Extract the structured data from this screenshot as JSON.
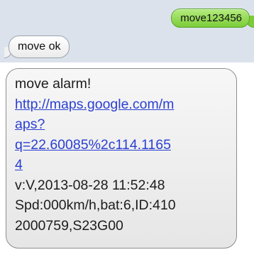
{
  "conversation": {
    "outgoing": {
      "text": "move123456"
    },
    "reply": {
      "text": "move ok"
    },
    "alarm": {
      "title": "move alarm!",
      "link_lines": [
        "http://maps.google.com/m",
        "aps?",
        "q=22.60085%2c114.1165",
        "4"
      ],
      "body_lines": [
        "v:V,2013-08-28 11:52:48",
        "Spd:000km/h,bat:6,ID:410",
        "2000759,S23G00"
      ]
    }
  },
  "colors": {
    "panel_bg": "#dbe2ec",
    "outgoing_bubble": "#7ccc39",
    "incoming_bubble": "#f0f0f0",
    "link": "#2a3fd2"
  }
}
